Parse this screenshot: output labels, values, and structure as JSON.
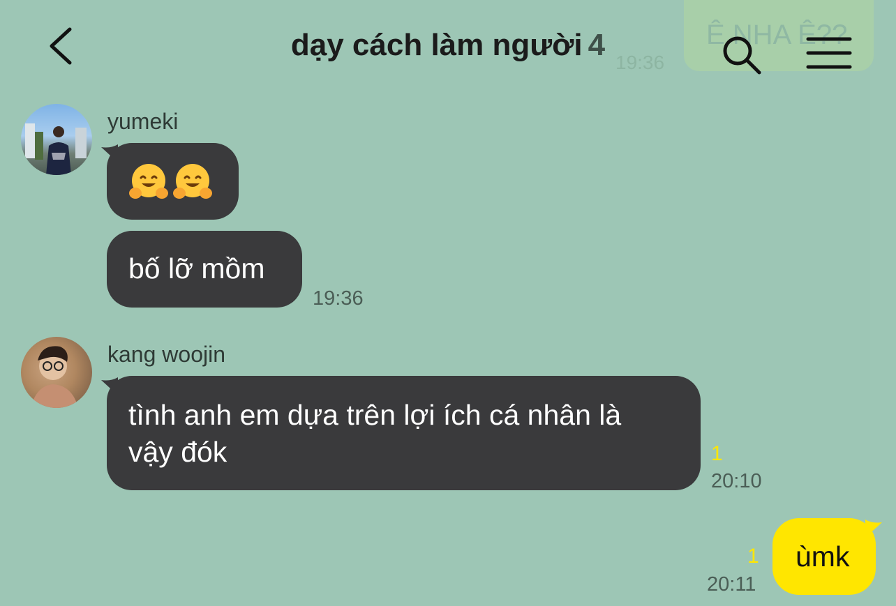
{
  "header": {
    "title": "dạy cách làm người",
    "member_count": "4",
    "icons": {
      "back": "back-chevron-icon",
      "search": "search-icon",
      "menu": "menu-icon"
    }
  },
  "pinned_faded": {
    "text": "Ê NHA Ê??",
    "time": "19:36"
  },
  "messages": [
    {
      "sender": "yumeki",
      "bubbles": [
        {
          "type": "emoji",
          "emoji": [
            "hugging-face-icon",
            "hugging-face-icon"
          ]
        },
        {
          "type": "text",
          "text": "bố lỡ mồm"
        }
      ],
      "time": "19:36"
    },
    {
      "sender": "kang woojin",
      "bubbles": [
        {
          "type": "text",
          "lines": [
            "tình anh em dựa trên lợi ích cá nhân là",
            "vậy đók"
          ]
        }
      ],
      "unread": "1",
      "time": "20:10"
    },
    {
      "sender": "me",
      "bubbles": [
        {
          "type": "text",
          "text": "ùmk"
        }
      ],
      "unread": "1",
      "time": "20:11"
    }
  ],
  "colors": {
    "background": "#9dc6b5",
    "other_bubble": "#3a3a3c",
    "my_bubble": "#ffe600",
    "unread": "#ffe600"
  }
}
